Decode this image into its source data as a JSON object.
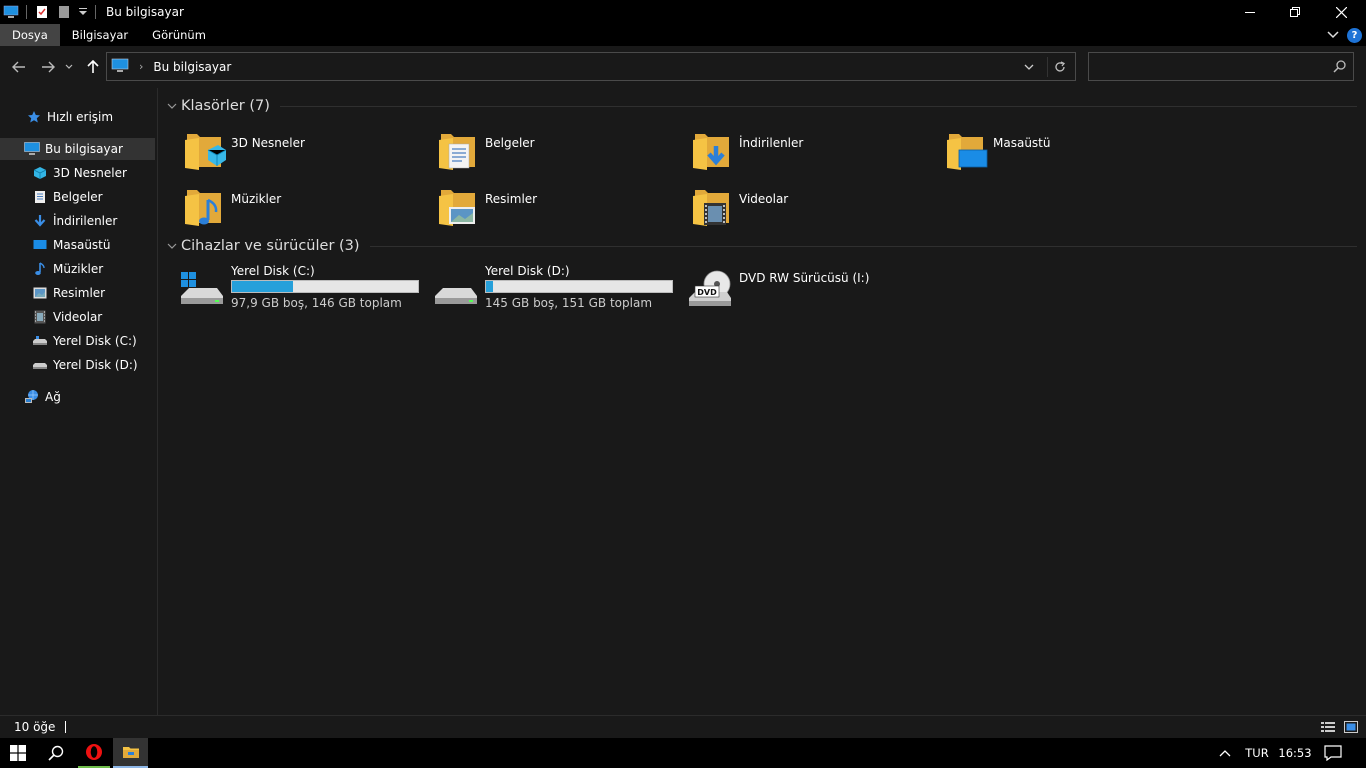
{
  "window": {
    "title": "Bu bilgisayar"
  },
  "ribbon": {
    "tabs": [
      {
        "label": "Dosya",
        "active": true
      },
      {
        "label": "Bilgisayar",
        "active": false
      },
      {
        "label": "Görünüm",
        "active": false
      }
    ],
    "help_label": "?"
  },
  "address": {
    "location": "Bu bilgisayar"
  },
  "search": {
    "placeholder": ""
  },
  "sidebar": {
    "items": [
      {
        "label": "Hızlı erişim",
        "icon": "star-icon"
      },
      {
        "label": "Bu bilgisayar",
        "icon": "computer-icon",
        "selected": true
      },
      {
        "label": "3D Nesneler",
        "icon": "cube-icon"
      },
      {
        "label": "Belgeler",
        "icon": "document-icon"
      },
      {
        "label": "İndirilenler",
        "icon": "download-icon"
      },
      {
        "label": "Masaüstü",
        "icon": "desktop-icon"
      },
      {
        "label": "Müzikler",
        "icon": "music-icon"
      },
      {
        "label": "Resimler",
        "icon": "picture-icon"
      },
      {
        "label": "Videolar",
        "icon": "video-icon"
      },
      {
        "label": "Yerel Disk (C:)",
        "icon": "drive-icon"
      },
      {
        "label": "Yerel Disk (D:)",
        "icon": "drive-icon"
      },
      {
        "label": "Ağ",
        "icon": "network-icon"
      }
    ]
  },
  "content": {
    "folders_header": "Klasörler (7)",
    "folders": [
      {
        "name": "3D Nesneler",
        "icon": "folder-3d-icon"
      },
      {
        "name": "Belgeler",
        "icon": "folder-documents-icon"
      },
      {
        "name": "İndirilenler",
        "icon": "folder-downloads-icon"
      },
      {
        "name": "Masaüstü",
        "icon": "folder-desktop-icon"
      },
      {
        "name": "Müzikler",
        "icon": "folder-music-icon"
      },
      {
        "name": "Resimler",
        "icon": "folder-pictures-icon"
      },
      {
        "name": "Videolar",
        "icon": "folder-videos-icon"
      }
    ],
    "drives_header": "Cihazlar ve sürücüler (3)",
    "drives": [
      {
        "name": "Yerel Disk (C:)",
        "info": "97,9 GB boş, 146 GB toplam",
        "used_fraction": 0.33,
        "icon": "windows-drive-icon"
      },
      {
        "name": "Yerel Disk (D:)",
        "info": "145 GB boş, 151 GB toplam",
        "used_fraction": 0.04,
        "icon": "drive-icon"
      },
      {
        "name": "DVD RW Sürücüsü (I:)",
        "info": "",
        "icon": "dvd-drive-icon",
        "badge": "DVD"
      }
    ]
  },
  "statusbar": {
    "item_count": "10 öğe"
  },
  "taskbar": {
    "language": "TUR",
    "time": "16:53"
  },
  "colors": {
    "accent": "#26a0da",
    "folder": "#f5c344",
    "background": "#191919",
    "selected": "#333333"
  }
}
